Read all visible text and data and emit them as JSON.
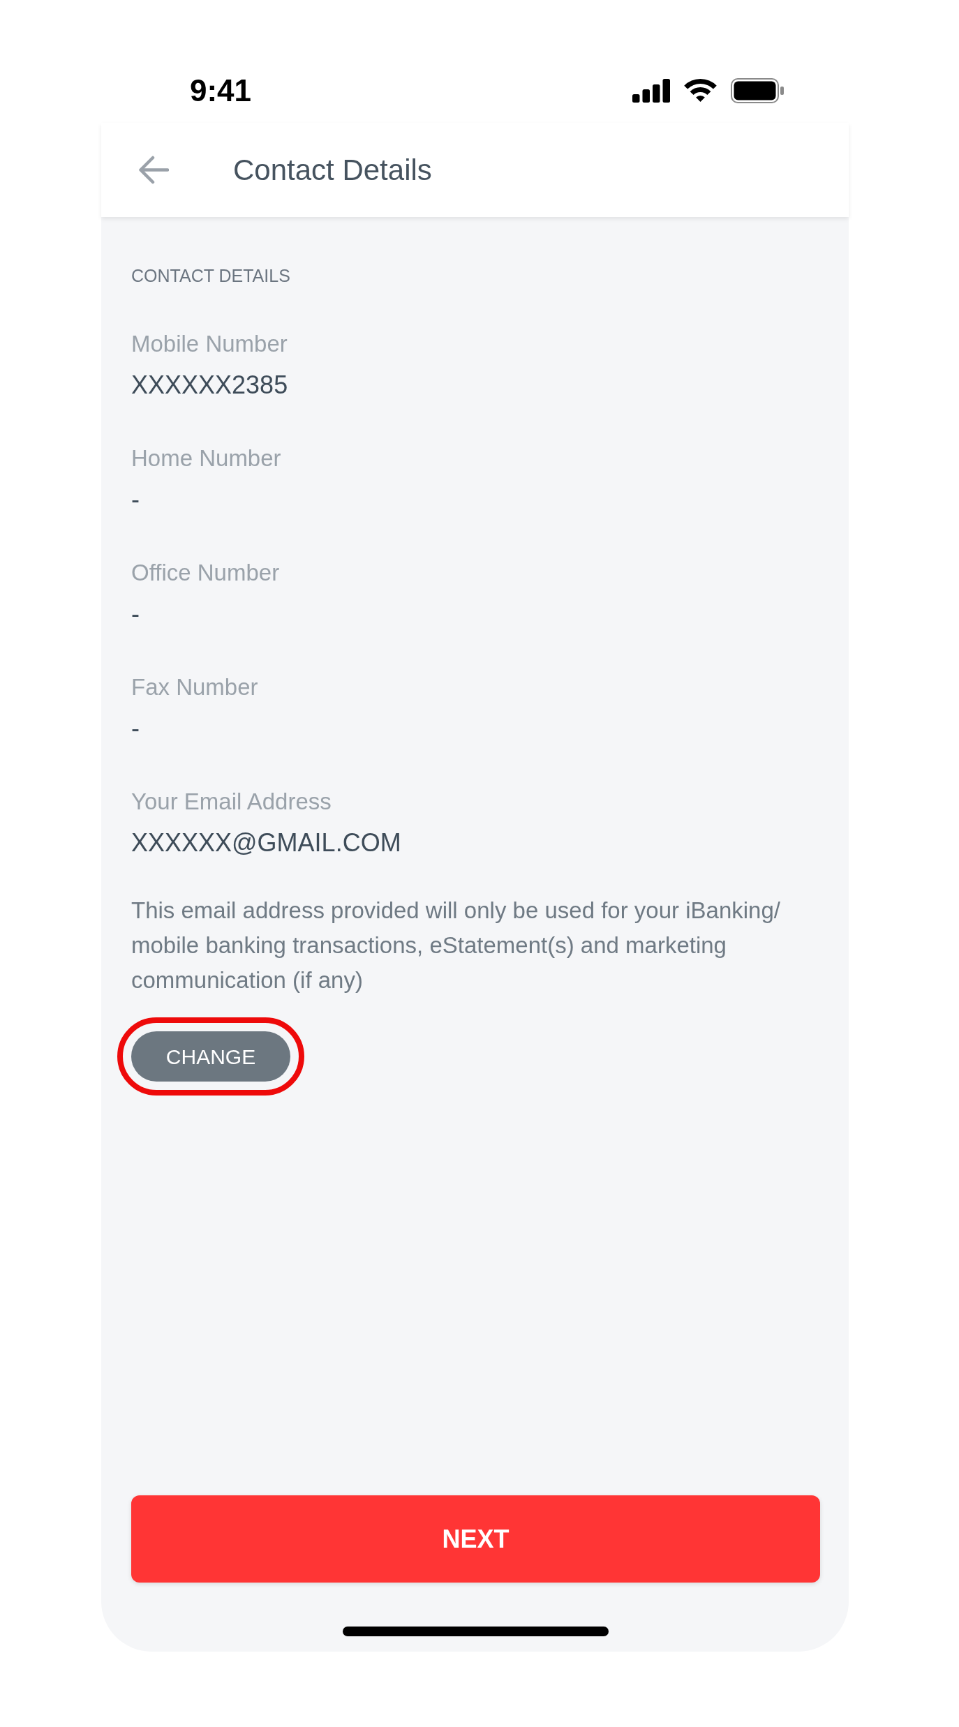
{
  "status_bar": {
    "time": "9:41"
  },
  "header": {
    "title": "Contact Details"
  },
  "section": {
    "heading": "CONTACT DETAILS",
    "fields": [
      {
        "label": "Mobile Number",
        "value": "XXXXXX2385"
      },
      {
        "label": "Home Number",
        "value": "-"
      },
      {
        "label": "Office Number",
        "value": "-"
      },
      {
        "label": "Fax Number",
        "value": "-"
      },
      {
        "label": "Your Email Address",
        "value": "XXXXXX@GMAIL.COM"
      }
    ]
  },
  "disclaimer": "This email address provided will only be used for your iBanking/ mobile banking transactions, eStatement(s) and marketing communication (if any)",
  "change_button": {
    "label": "CHANGE",
    "highlighted": true
  },
  "next_button": {
    "label": "NEXT"
  }
}
